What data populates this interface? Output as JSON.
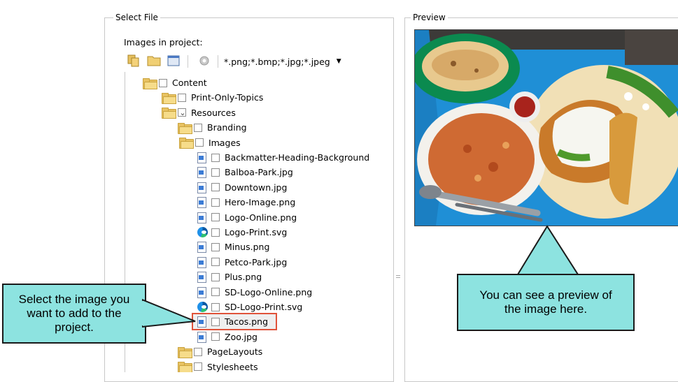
{
  "select_file": {
    "title": "Select File",
    "images_label": "Images in project:",
    "filter": "*.png;*.bmp;*.jpg;*.jpeg",
    "toolbar_icons": [
      "copy-icon",
      "open-folder-icon",
      "window-icon",
      "gear-icon"
    ]
  },
  "preview": {
    "title": "Preview"
  },
  "tree": [
    {
      "label": "Content",
      "kind": "folder"
    },
    {
      "label": "Print-Only-Topics",
      "kind": "folder",
      "expander": "›"
    },
    {
      "label": "Resources",
      "kind": "folder",
      "expander": "⌄"
    },
    {
      "label": "Branding",
      "kind": "folder"
    },
    {
      "label": "Images",
      "kind": "folder",
      "expander": "⌄"
    },
    {
      "label": "Backmatter-Heading-Background",
      "kind": "image"
    },
    {
      "label": "Balboa-Park.jpg",
      "kind": "image"
    },
    {
      "label": "Downtown.jpg",
      "kind": "image"
    },
    {
      "label": "Hero-Image.png",
      "kind": "image"
    },
    {
      "label": "Logo-Online.png",
      "kind": "image"
    },
    {
      "label": "Logo-Print.svg",
      "kind": "svg"
    },
    {
      "label": "Minus.png",
      "kind": "image"
    },
    {
      "label": "Petco-Park.jpg",
      "kind": "image"
    },
    {
      "label": "Plus.png",
      "kind": "image"
    },
    {
      "label": "SD-Logo-Online.png",
      "kind": "image"
    },
    {
      "label": "SD-Logo-Print.svg",
      "kind": "svg"
    },
    {
      "label": "Tacos.png",
      "kind": "image",
      "selected": true
    },
    {
      "label": "Zoo.jpg",
      "kind": "image"
    },
    {
      "label": "PageLayouts",
      "kind": "folder"
    },
    {
      "label": "Stylesheets",
      "kind": "folder"
    }
  ],
  "callouts": {
    "left": "Select the image you want to add to the project.",
    "right": "You can see a preview of the image here."
  },
  "colors": {
    "callout_fill": "#8de3e0",
    "selection_box": "#e0533a",
    "tray": "#1f8fd6"
  }
}
